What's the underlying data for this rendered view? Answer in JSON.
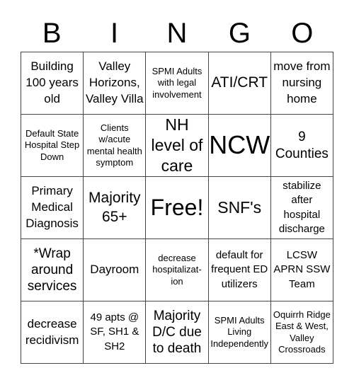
{
  "header": {
    "letters": [
      "B",
      "I",
      "N",
      "G",
      "O"
    ]
  },
  "cells": [
    [
      "Building 100 years old",
      "Valley Horizons, Valley Villa",
      "SPMI Adults with legal involvement",
      "ATI/CRT",
      "move from nursing home"
    ],
    [
      "Default State Hospital Step Down",
      "Clients w/acute mental health symptom",
      "NH level of care",
      "NCW",
      "9 Counties"
    ],
    [
      "Primary Medical Diagnosis",
      "Majority 65+",
      "Free!",
      "SNF's",
      "stabilize after hospital discharge"
    ],
    [
      "*Wrap around services",
      "Dayroom",
      "decrease hospitalizat-ion",
      "default for frequent ED utilizers",
      "LCSW APRN SSW Team"
    ],
    [
      "decrease recidivism",
      "49 apts @ SF, SH1 & SH2",
      "Majority D/C due to death",
      "SPMI Adults Living Independently",
      "Oquirrh Ridge East & West, Valley Crossroads"
    ]
  ]
}
